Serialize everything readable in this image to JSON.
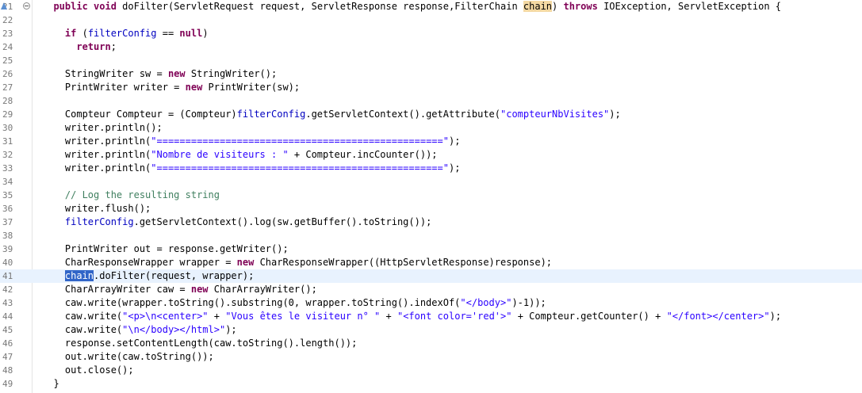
{
  "editor": {
    "current_line": "41",
    "lines": [
      {
        "num": "21",
        "indent": "  ",
        "tokens": [
          [
            "kw",
            "public"
          ],
          [
            "t",
            " "
          ],
          [
            "kw",
            "void"
          ],
          [
            "t",
            " doFilter(ServletRequest request, ServletResponse response,FilterChain "
          ],
          [
            "occ",
            "chain"
          ],
          [
            "t",
            ") "
          ],
          [
            "kw",
            "throws"
          ],
          [
            "t",
            " IOException, ServletException {"
          ]
        ]
      },
      {
        "num": "22",
        "indent": "",
        "tokens": []
      },
      {
        "num": "23",
        "indent": "    ",
        "tokens": [
          [
            "kw",
            "if"
          ],
          [
            "t",
            " ("
          ],
          [
            "fld",
            "filterConfig"
          ],
          [
            "t",
            " == "
          ],
          [
            "kw",
            "null"
          ],
          [
            "t",
            ")"
          ]
        ]
      },
      {
        "num": "24",
        "indent": "      ",
        "tokens": [
          [
            "kw",
            "return"
          ],
          [
            "t",
            ";"
          ]
        ]
      },
      {
        "num": "25",
        "indent": "",
        "tokens": []
      },
      {
        "num": "26",
        "indent": "    ",
        "tokens": [
          [
            "t",
            "StringWriter sw = "
          ],
          [
            "kw",
            "new"
          ],
          [
            "t",
            " StringWriter();"
          ]
        ]
      },
      {
        "num": "27",
        "indent": "    ",
        "tokens": [
          [
            "t",
            "PrintWriter writer = "
          ],
          [
            "kw",
            "new"
          ],
          [
            "t",
            " PrintWriter(sw);"
          ]
        ]
      },
      {
        "num": "28",
        "indent": "",
        "tokens": []
      },
      {
        "num": "29",
        "indent": "    ",
        "tokens": [
          [
            "t",
            "Compteur Compteur = (Compteur)"
          ],
          [
            "fld",
            "filterConfig"
          ],
          [
            "t",
            ".getServletContext().getAttribute("
          ],
          [
            "str",
            "\"compteurNbVisites\""
          ],
          [
            "t",
            ");"
          ]
        ]
      },
      {
        "num": "30",
        "indent": "    ",
        "tokens": [
          [
            "t",
            "writer.println();"
          ]
        ]
      },
      {
        "num": "31",
        "indent": "    ",
        "tokens": [
          [
            "t",
            "writer.println("
          ],
          [
            "str",
            "\"==================================================\""
          ],
          [
            "t",
            ");"
          ]
        ]
      },
      {
        "num": "32",
        "indent": "    ",
        "tokens": [
          [
            "t",
            "writer.println("
          ],
          [
            "str",
            "\"Nombre de visiteurs : \""
          ],
          [
            "t",
            " + Compteur.incCounter());"
          ]
        ]
      },
      {
        "num": "33",
        "indent": "    ",
        "tokens": [
          [
            "t",
            "writer.println("
          ],
          [
            "str",
            "\"==================================================\""
          ],
          [
            "t",
            ");"
          ]
        ]
      },
      {
        "num": "34",
        "indent": "",
        "tokens": []
      },
      {
        "num": "35",
        "indent": "    ",
        "tokens": [
          [
            "cm",
            "// Log the resulting string"
          ]
        ]
      },
      {
        "num": "36",
        "indent": "    ",
        "tokens": [
          [
            "t",
            "writer.flush();"
          ]
        ]
      },
      {
        "num": "37",
        "indent": "    ",
        "tokens": [
          [
            "fld",
            "filterConfig"
          ],
          [
            "t",
            ".getServletContext().log(sw.getBuffer().toString());"
          ]
        ]
      },
      {
        "num": "38",
        "indent": "",
        "tokens": []
      },
      {
        "num": "39",
        "indent": "    ",
        "tokens": [
          [
            "t",
            "PrintWriter out = response.getWriter();"
          ]
        ]
      },
      {
        "num": "40",
        "indent": "    ",
        "tokens": [
          [
            "t",
            "CharResponseWrapper wrapper = "
          ],
          [
            "kw",
            "new"
          ],
          [
            "t",
            " CharResponseWrapper((HttpServletResponse)response);"
          ]
        ]
      },
      {
        "num": "41",
        "indent": "    ",
        "tokens": [
          [
            "sel",
            "chain"
          ],
          [
            "t",
            ".doFilter(request, wrapper);"
          ]
        ]
      },
      {
        "num": "42",
        "indent": "    ",
        "tokens": [
          [
            "t",
            "CharArrayWriter caw = "
          ],
          [
            "kw",
            "new"
          ],
          [
            "t",
            " CharArrayWriter();"
          ]
        ]
      },
      {
        "num": "43",
        "indent": "    ",
        "tokens": [
          [
            "t",
            "caw.write(wrapper.toString().substring(0, wrapper.toString().indexOf("
          ],
          [
            "str",
            "\"</body>\""
          ],
          [
            "t",
            ")-1));"
          ]
        ]
      },
      {
        "num": "44",
        "indent": "    ",
        "tokens": [
          [
            "t",
            "caw.write("
          ],
          [
            "str",
            "\"<p>\\n<center>\""
          ],
          [
            "t",
            " + "
          ],
          [
            "str",
            "\"Vous êtes le visiteur n° \""
          ],
          [
            "t",
            " + "
          ],
          [
            "str",
            "\"<font color='red'>\""
          ],
          [
            "t",
            " + Compteur.getCounter() + "
          ],
          [
            "str",
            "\"</font></center>\""
          ],
          [
            "t",
            ");"
          ]
        ]
      },
      {
        "num": "45",
        "indent": "    ",
        "tokens": [
          [
            "t",
            "caw.write("
          ],
          [
            "str",
            "\"\\n</body></html>\""
          ],
          [
            "t",
            ");"
          ]
        ]
      },
      {
        "num": "46",
        "indent": "    ",
        "tokens": [
          [
            "t",
            "response.setContentLength(caw.toString().length());"
          ]
        ]
      },
      {
        "num": "47",
        "indent": "    ",
        "tokens": [
          [
            "t",
            "out.write(caw.toString());"
          ]
        ]
      },
      {
        "num": "48",
        "indent": "    ",
        "tokens": [
          [
            "t",
            "out.close();"
          ]
        ]
      },
      {
        "num": "49",
        "indent": "  ",
        "tokens": [
          [
            "t",
            "}"
          ]
        ]
      }
    ]
  },
  "colors": {
    "keyword": "#7f0055",
    "string": "#2a00ff",
    "field": "#0000c0",
    "comment": "#3f7f5f",
    "current_line_bg": "#e8f2fe",
    "selection_bg": "#3165c8",
    "occurrence_bg": "#f4d9a3"
  },
  "icons": {
    "fold": "fold-collapse-icon",
    "override_marker": "override-marker-icon"
  }
}
